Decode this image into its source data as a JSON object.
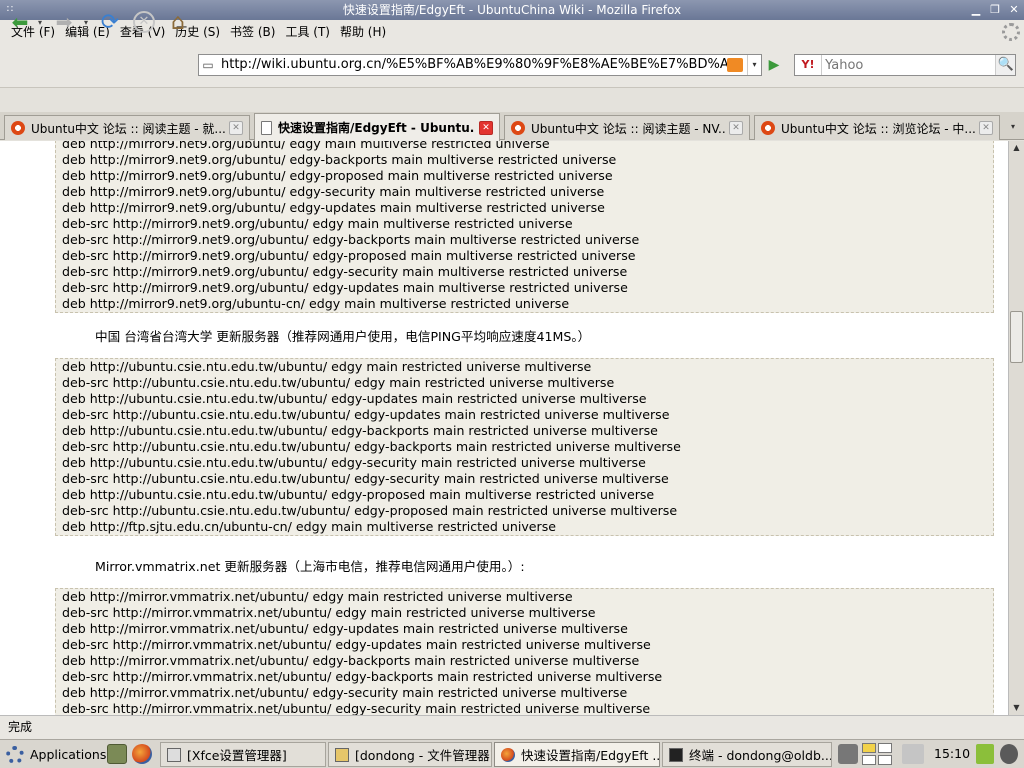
{
  "window": {
    "title": "快速设置指南/EdgyEft - UbuntuChina Wiki - Mozilla Firefox",
    "menu_glyph": "∷",
    "minimize_glyph": "▁",
    "maximize_glyph": "❐",
    "close_glyph": "✕"
  },
  "menu": [
    "文件 (F)",
    "编辑 (E)",
    "查看 (V)",
    "历史 (S)",
    "书签 (B)",
    "工具 (T)",
    "帮助 (H)"
  ],
  "nav": {
    "back_glyph": "⬅",
    "forward_glyph": "➡",
    "reload_glyph": "⟳",
    "stop_glyph": "✕",
    "home_glyph": "⌂",
    "dropdown_glyph": "▾",
    "url": "http://wiki.ubuntu.org.cn/%E5%BF%AB%E9%80%9F%E8%AE%BE%E7%BD%AE%E6%8",
    "go_glyph": "▶",
    "search_engine": "Y!",
    "search_placeholder": "Yahoo",
    "search_glyph": "🔍"
  },
  "tabs": [
    {
      "label": "Ubuntu中文 论坛 :: 阅读主题 - 就...",
      "icon": "ubuntu",
      "active": false
    },
    {
      "label": "快速设置指南/EdgyEft - Ubuntu...",
      "icon": "document",
      "active": true
    },
    {
      "label": "Ubuntu中文 论坛 :: 阅读主题 - NV...",
      "icon": "ubuntu",
      "active": false
    },
    {
      "label": "Ubuntu中文 论坛 :: 浏览论坛 - 中...",
      "icon": "ubuntu",
      "active": false
    }
  ],
  "tab_close_glyph": "✕",
  "tab_list_glyph": "▾",
  "content": {
    "block1": [
      "deb http://mirror9.net9.org/ubuntu/ edgy main multiverse restricted universe",
      "deb http://mirror9.net9.org/ubuntu/ edgy-backports main multiverse restricted universe",
      "deb http://mirror9.net9.org/ubuntu/ edgy-proposed main multiverse restricted universe",
      "deb http://mirror9.net9.org/ubuntu/ edgy-security main multiverse restricted universe",
      "deb http://mirror9.net9.org/ubuntu/ edgy-updates main multiverse restricted universe",
      "deb-src http://mirror9.net9.org/ubuntu/ edgy main multiverse restricted universe",
      "deb-src http://mirror9.net9.org/ubuntu/ edgy-backports main multiverse restricted universe",
      "deb-src http://mirror9.net9.org/ubuntu/ edgy-proposed main multiverse restricted universe",
      "deb-src http://mirror9.net9.org/ubuntu/ edgy-security main multiverse restricted universe",
      "deb-src http://mirror9.net9.org/ubuntu/ edgy-updates main multiverse restricted universe",
      "deb http://mirror9.net9.org/ubuntu-cn/ edgy main multiverse restricted universe"
    ],
    "para1": "中国 台湾省台湾大学 更新服务器（推荐网通用户使用，电信PING平均响应速度41MS。）",
    "block2": [
      "deb http://ubuntu.csie.ntu.edu.tw/ubuntu/ edgy main restricted universe multiverse",
      "deb-src http://ubuntu.csie.ntu.edu.tw/ubuntu/ edgy main restricted universe multiverse",
      "deb http://ubuntu.csie.ntu.edu.tw/ubuntu/ edgy-updates main restricted universe multiverse",
      "deb-src http://ubuntu.csie.ntu.edu.tw/ubuntu/ edgy-updates main restricted universe multiverse",
      "deb http://ubuntu.csie.ntu.edu.tw/ubuntu/ edgy-backports main restricted universe multiverse",
      "deb-src http://ubuntu.csie.ntu.edu.tw/ubuntu/ edgy-backports main restricted universe multiverse",
      "deb http://ubuntu.csie.ntu.edu.tw/ubuntu/ edgy-security main restricted universe multiverse",
      "deb-src http://ubuntu.csie.ntu.edu.tw/ubuntu/ edgy-security main restricted universe multiverse",
      "deb http://ubuntu.csie.ntu.edu.tw/ubuntu/ edgy-proposed main multiverse restricted universe",
      "deb-src http://ubuntu.csie.ntu.edu.tw/ubuntu/ edgy-proposed main restricted universe multiverse",
      "deb http://ftp.sjtu.edu.cn/ubuntu-cn/ edgy main multiverse restricted universe"
    ],
    "para2": "Mirror.vmmatrix.net 更新服务器（上海市电信，推荐电信网通用户使用。）:",
    "block3": [
      "deb http://mirror.vmmatrix.net/ubuntu/ edgy main restricted universe multiverse",
      "deb-src http://mirror.vmmatrix.net/ubuntu/ edgy main restricted universe multiverse",
      "deb http://mirror.vmmatrix.net/ubuntu/ edgy-updates main restricted universe multiverse",
      "deb-src http://mirror.vmmatrix.net/ubuntu/ edgy-updates main restricted universe multiverse",
      "deb http://mirror.vmmatrix.net/ubuntu/ edgy-backports main restricted universe multiverse",
      "deb-src http://mirror.vmmatrix.net/ubuntu/ edgy-backports main restricted universe multiverse",
      "deb http://mirror.vmmatrix.net/ubuntu/ edgy-security main restricted universe multiverse",
      "deb-src http://mirror.vmmatrix.net/ubuntu/ edgy-security main restricted universe multiverse"
    ]
  },
  "scroll": {
    "up_glyph": "▲",
    "down_glyph": "▼"
  },
  "status": "完成",
  "taskbar": {
    "applications": "Applications",
    "tasks": [
      {
        "label": "[Xfce设置管理器]",
        "icon": "settings",
        "active": false
      },
      {
        "label": "[dondong - 文件管理器]",
        "icon": "folder",
        "active": false
      },
      {
        "label": "快速设置指南/EdgyEft ...",
        "icon": "firefox",
        "active": true
      },
      {
        "label": "终端 - dondong@oldb...",
        "icon": "terminal",
        "active": false
      }
    ],
    "clock": "15:10"
  }
}
